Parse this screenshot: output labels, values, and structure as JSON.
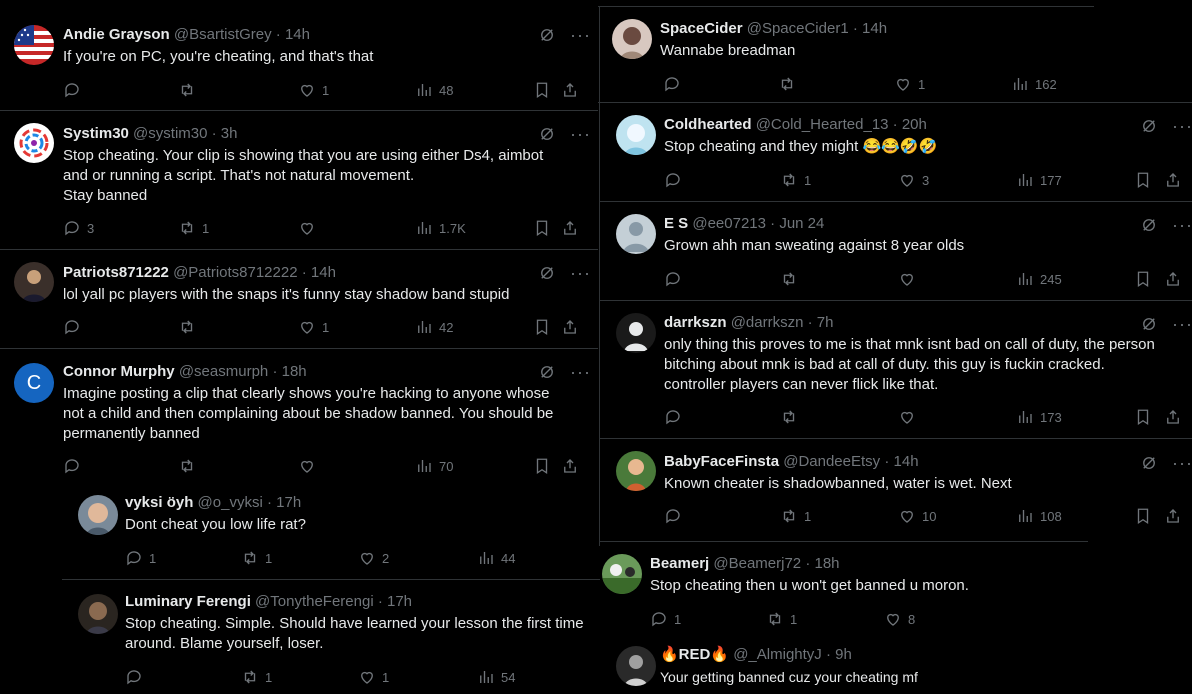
{
  "left": [
    {
      "name": "Andie Grayson",
      "handle": "@BsartistGrey",
      "time": "· 14h",
      "text": "If you're on PC, you're cheating, and that's that",
      "replies": "",
      "reposts": "",
      "likes": "1",
      "views": "48"
    },
    {
      "name": "Systim30",
      "handle": "@systim30",
      "time": "· 3h",
      "text": "Stop cheating. Your clip is showing that you are using either Ds4, aimbot\nand or running a script. That's not natural movement.\nStay banned",
      "replies": "3",
      "reposts": "1",
      "likes": "",
      "views": "1.7K"
    },
    {
      "name": "Patriots871222",
      "handle": "@Patriots8712222",
      "time": "· 14h",
      "text": "lol yall pc players with the snaps it's funny stay shadow band stupid",
      "replies": "",
      "reposts": "",
      "likes": "1",
      "views": "42"
    },
    {
      "name": "Connor Murphy",
      "handle": "@seasmurph",
      "time": "· 18h",
      "text": "Imagine posting a clip that clearly shows you're hacking to anyone whose\nnot a child and then complaining about be shadow banned. You should be\npermanently banned",
      "replies": "",
      "reposts": "",
      "likes": "",
      "views": "70"
    },
    {
      "name": "vyksi öyh",
      "handle": "@o_vyksi",
      "time": "· 17h",
      "text": "Dont cheat you low life rat?",
      "replies": "1",
      "reposts": "1",
      "likes": "2",
      "views": "44"
    },
    {
      "name": "Luminary Ferengi",
      "handle": "@TonytheFerengi",
      "time": "· 17h",
      "text": "Stop cheating. Simple. Should have learned your lesson the first time\naround.  Blame yourself, loser.",
      "replies": "",
      "reposts": "1",
      "likes": "1",
      "views": "54"
    }
  ],
  "right": [
    {
      "name": "SpaceCider",
      "handle": "@SpaceCider1",
      "time": "· 14h",
      "text": "Wannabe breadman",
      "replies": "",
      "reposts": "",
      "likes": "1",
      "views": "162"
    },
    {
      "name": "Coldhearted",
      "handle": "@Cold_Hearted_13",
      "time": "· 20h",
      "text": "Stop cheating and they might 😂😂🤣🤣",
      "replies": "",
      "reposts": "1",
      "likes": "3",
      "views": "177"
    },
    {
      "name": "E S",
      "handle": "@ee07213",
      "time": "· Jun 24",
      "text": "Grown ahh man sweating against 8 year olds",
      "replies": "",
      "reposts": "",
      "likes": "",
      "views": "245"
    },
    {
      "name": "darrkszn",
      "handle": "@darrkszn",
      "time": "· 7h",
      "text": "only thing this proves to me is that mnk isnt bad on call of duty, the person\nbitching about mnk is bad at call of duty. this guy is fuckin cracked.\ncontroller players can never flick like that.",
      "replies": "",
      "reposts": "",
      "likes": "",
      "views": "173"
    },
    {
      "name": "BabyFaceFinsta",
      "handle": "@DandeeEtsy",
      "time": "· 14h",
      "text": "Known cheater is shadowbanned, water is wet. Next",
      "replies": "",
      "reposts": "1",
      "likes": "10",
      "views": "108"
    },
    {
      "name": "Beamerj",
      "handle": "@Beamerj72",
      "time": "· 18h",
      "text": "Stop cheating then u won't get banned u moron.",
      "replies": "1",
      "reposts": "1",
      "likes": "8",
      "views": ""
    },
    {
      "name": "🔥RED🔥",
      "handle": "@_AlmightyJ",
      "time": "· 9h",
      "text": "Your getting banned cuz your cheating mf",
      "replies": "",
      "reposts": "",
      "likes": "",
      "views": ""
    }
  ],
  "colors": {
    "bg": "#000000",
    "text": "#e7e9ea",
    "muted": "#71767b",
    "divider": "#2f3336",
    "connor_avatar": "#1565c0"
  }
}
